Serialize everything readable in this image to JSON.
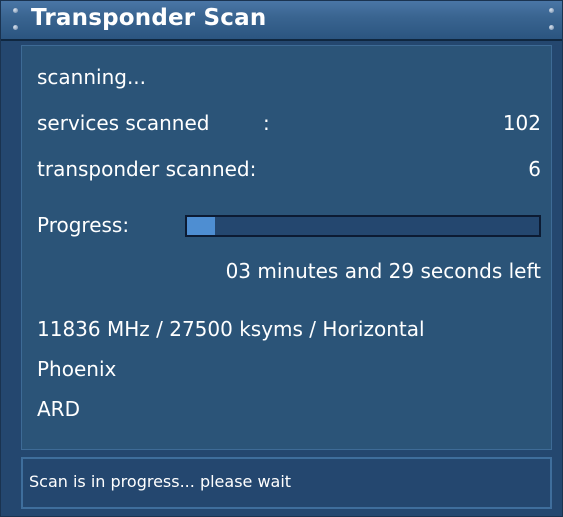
{
  "window": {
    "title": "Transponder Scan"
  },
  "scan": {
    "state": "scanning...",
    "services_label": "services scanned",
    "services_sep": ":",
    "services_value": "102",
    "transponders_label": "transponder scanned:",
    "transponders_value": "6",
    "progress_label": "Progress:",
    "progress_fraction": 0.08,
    "time_left": "03 minutes and 29 seconds left",
    "transponder_info": "11836 MHz / 27500 ksyms / Horizontal",
    "provider": "Phoenix",
    "channel": "ARD"
  },
  "statusbar": {
    "message": "Scan is in progress... please wait"
  },
  "colors": {
    "background": "#24476f",
    "titlebar": "#3a6591",
    "progress_fill": "#4e8ed2",
    "text": "#ffffff"
  }
}
